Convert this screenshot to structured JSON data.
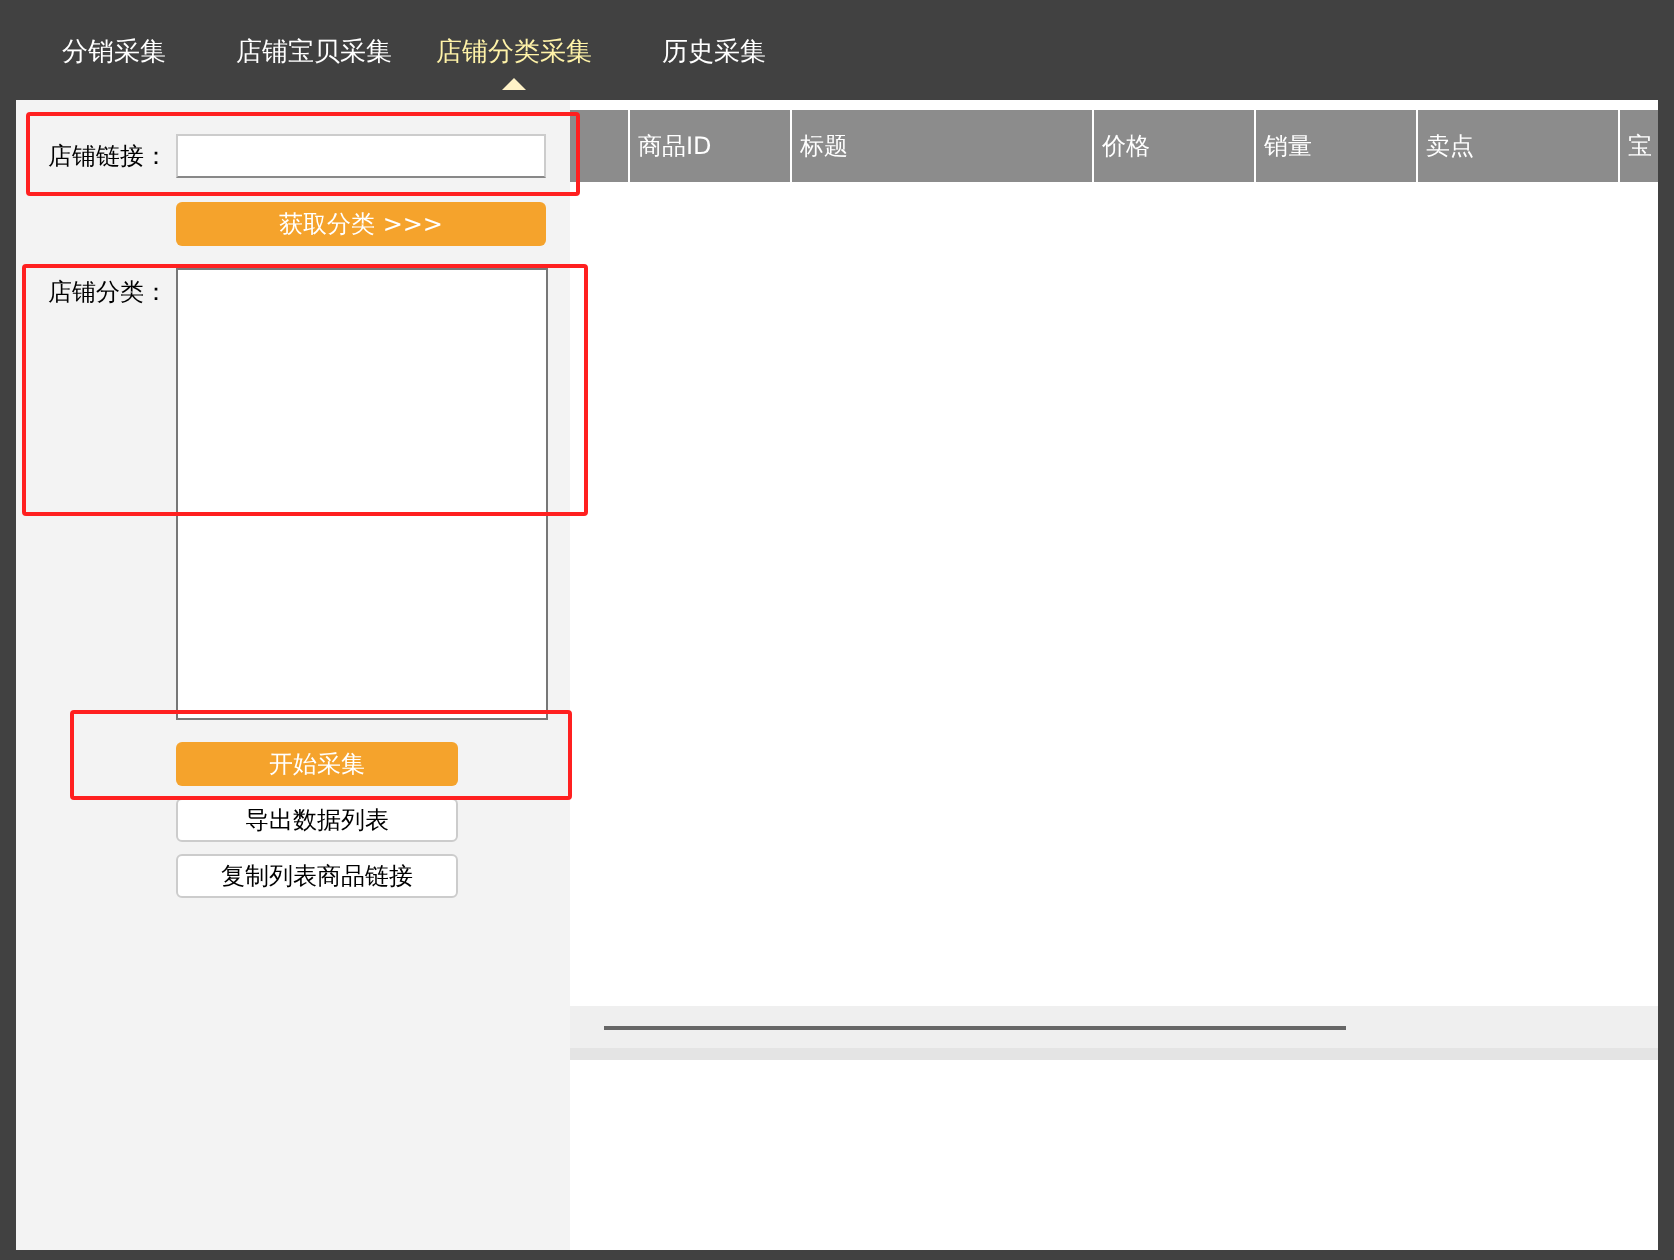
{
  "tabs": [
    {
      "label": "分销采集",
      "selected": false
    },
    {
      "label": "店铺宝贝采集",
      "selected": false
    },
    {
      "label": "店铺分类采集",
      "selected": true
    },
    {
      "label": "历史采集",
      "selected": false
    }
  ],
  "form": {
    "shop_link": {
      "label": "店铺链接："
    },
    "fetch_button": "获取分类 >>>",
    "category": {
      "label": "店铺分类："
    }
  },
  "actions": [
    {
      "label": "开始采集",
      "kind": "primary"
    },
    {
      "label": "导出数据列表",
      "kind": "plain"
    },
    {
      "label": "复制列表商品链接",
      "kind": "plain"
    }
  ],
  "table": {
    "columns": [
      "",
      "商品ID",
      "标题",
      "价格",
      "销量",
      "卖点",
      "宝"
    ]
  }
}
